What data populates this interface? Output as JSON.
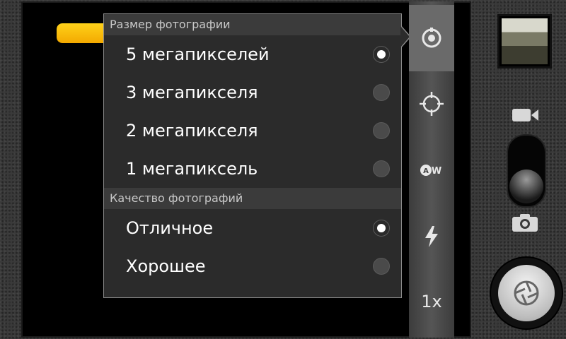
{
  "zoom": {
    "level_fraction": 0.47,
    "label": "1x"
  },
  "menu": {
    "sections": [
      {
        "header": "Размер фотографии",
        "options": [
          {
            "label": "5 мегапикселей",
            "selected": true
          },
          {
            "label": "3 мегапикселя",
            "selected": false
          },
          {
            "label": "2 мегапикселя",
            "selected": false
          },
          {
            "label": "1 мегапиксель",
            "selected": false
          }
        ]
      },
      {
        "header": "Качество фотографий",
        "options": [
          {
            "label": "Отличное",
            "selected": true
          },
          {
            "label": "Хорошее",
            "selected": false
          }
        ]
      }
    ]
  },
  "rail": {
    "items": [
      "settings-icon",
      "focus-icon",
      "white-balance-auto-icon",
      "flash-auto-icon"
    ]
  },
  "mode_switch": {
    "modes": [
      "video",
      "photo"
    ],
    "current": "photo"
  },
  "colors": {
    "accent": "#f3b000",
    "menu_bg": "#2b2b2b"
  }
}
